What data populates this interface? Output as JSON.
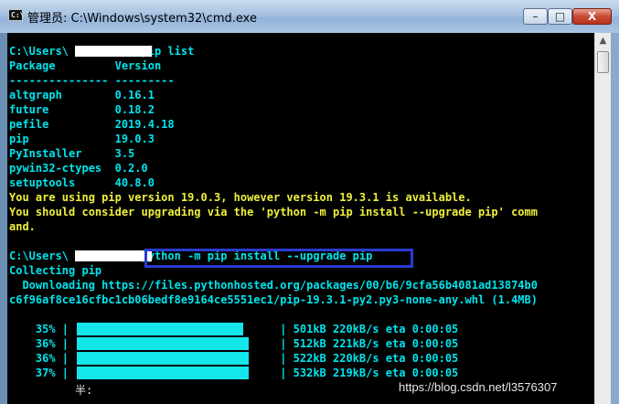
{
  "window": {
    "title": "管理员: C:\\Windows\\system32\\cmd.exe",
    "icon_text": "C:\\"
  },
  "controls": {
    "minimize": "–",
    "maximize": "□",
    "close": "X"
  },
  "console": {
    "lines": [
      {
        "text": "C:\\Users\\          >pip list",
        "color": "cyan"
      },
      {
        "text": "Package         Version",
        "color": "cyan"
      },
      {
        "text": "--------------- ---------",
        "color": "cyan"
      },
      {
        "text": "altgraph        0.16.1",
        "color": "cyan"
      },
      {
        "text": "future          0.18.2",
        "color": "cyan"
      },
      {
        "text": "pefile          2019.4.18",
        "color": "cyan"
      },
      {
        "text": "pip             19.0.3",
        "color": "cyan"
      },
      {
        "text": "PyInstaller     3.5",
        "color": "cyan"
      },
      {
        "text": "pywin32-ctypes  0.2.0",
        "color": "cyan"
      },
      {
        "text": "setuptools      40.8.0",
        "color": "cyan"
      },
      {
        "text": "You are using pip version 19.0.3, however version 19.3.1 is available.",
        "color": "yellow"
      },
      {
        "text": "You should consider upgrading via the 'python -m pip install --upgrade pip' comm",
        "color": "yellow"
      },
      {
        "text": "and.",
        "color": "yellow"
      },
      {
        "text": "",
        "color": "cyan"
      },
      {
        "text": "C:\\Users\\          >python -m pip install --upgrade pip",
        "color": "cyan"
      },
      {
        "text": "Collecting pip",
        "color": "cyan"
      },
      {
        "text": "  Downloading https://files.pythonhosted.org/packages/00/b6/9cfa56b4081ad13874b0",
        "color": "cyan"
      },
      {
        "text": "c6f96af8ce16cfbc1cb06bedf8e9164ce5551ec1/pip-19.3.1-py2.py3-none-any.whl (1.4MB)",
        "color": "cyan"
      },
      {
        "text": "",
        "color": "cyan"
      },
      {
        "text": "    35% |                                | 501kB 220kB/s eta 0:00:05",
        "color": "cyan"
      },
      {
        "text": "    36% |                                | 512kB 221kB/s eta 0:00:05",
        "color": "cyan"
      },
      {
        "text": "    36% |                                | 522kB 220kB/s eta 0:00:05",
        "color": "cyan"
      },
      {
        "text": "    37% |                                | 532kB 219kB/s eta 0:00:05",
        "color": "cyan"
      }
    ],
    "cursor_char": "半:",
    "progress_fraction": 0.37
  },
  "watermark": "https://blog.csdn.net/l3576307",
  "colors": {
    "cyan": "#00e5ee",
    "yellow": "#f0f03c",
    "highlight_box": "#2a3bd1",
    "progress_fill": "#14e7ea"
  }
}
